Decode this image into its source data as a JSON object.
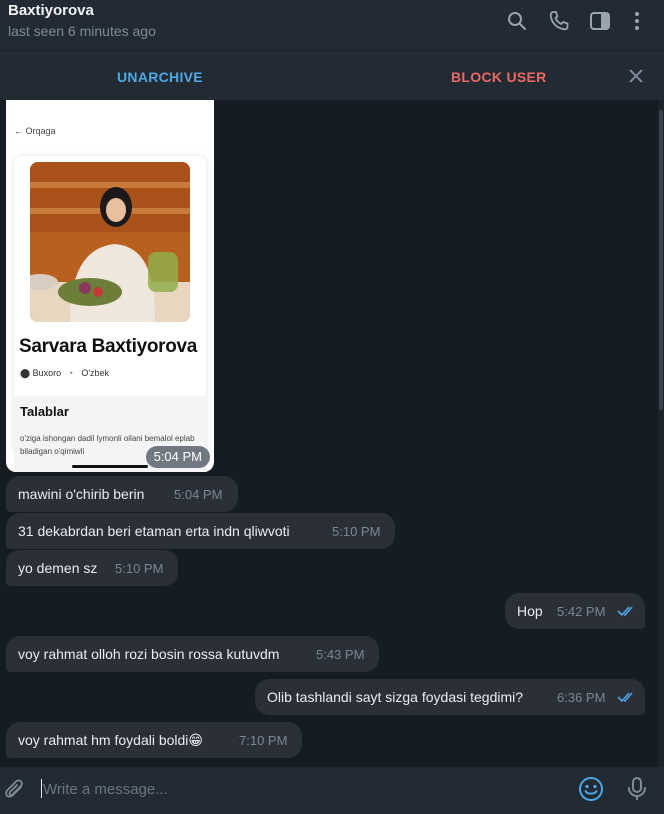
{
  "header": {
    "title": "Baxtiyorova",
    "subtitle": "last seen 6 minutes ago",
    "icons": [
      "search-icon",
      "phone-icon",
      "sidebar-icon",
      "more-icon"
    ]
  },
  "actions": {
    "unarchive": "UNARCHIVE",
    "block_user": "BLOCK USER"
  },
  "screenshot_msg": {
    "back_label": "Orqaga",
    "profile_name": "Sarvara Baxtiyorova",
    "location": "Buxoro",
    "language": "O'zbek",
    "requirements_title": "Talablar",
    "requirements_text": "o'ziga ishongan dadil lymonli oilani bemalol eplab biladigan o'qimiwli",
    "time": "5:04 PM"
  },
  "messages": [
    {
      "dir": "in",
      "text": "mawini o'chirib berin",
      "time": "5:04 PM"
    },
    {
      "dir": "in",
      "text": "31 dekabrdan beri etaman erta indn qliwvoti",
      "time": "5:10 PM"
    },
    {
      "dir": "in",
      "text": "yo demen sz",
      "time": "5:10 PM"
    },
    {
      "dir": "out",
      "text": "Hop",
      "time": "5:42 PM"
    },
    {
      "dir": "in",
      "text": "voy rahmat olloh rozi bosin rossa kutuvdm",
      "time": "5:43 PM"
    },
    {
      "dir": "out",
      "text": "Olib tashlandi sayt sizga foydasi tegdimi?",
      "time": "6:36 PM"
    },
    {
      "dir": "in",
      "text": "voy rahmat hm foydali boldi😁",
      "time": "7:10 PM"
    }
  ],
  "composer": {
    "placeholder": "Write a message..."
  },
  "colors": {
    "accent": "#4fa8e6",
    "danger": "#ec6863",
    "bubble": "#2b3038",
    "background": "#161c24"
  }
}
